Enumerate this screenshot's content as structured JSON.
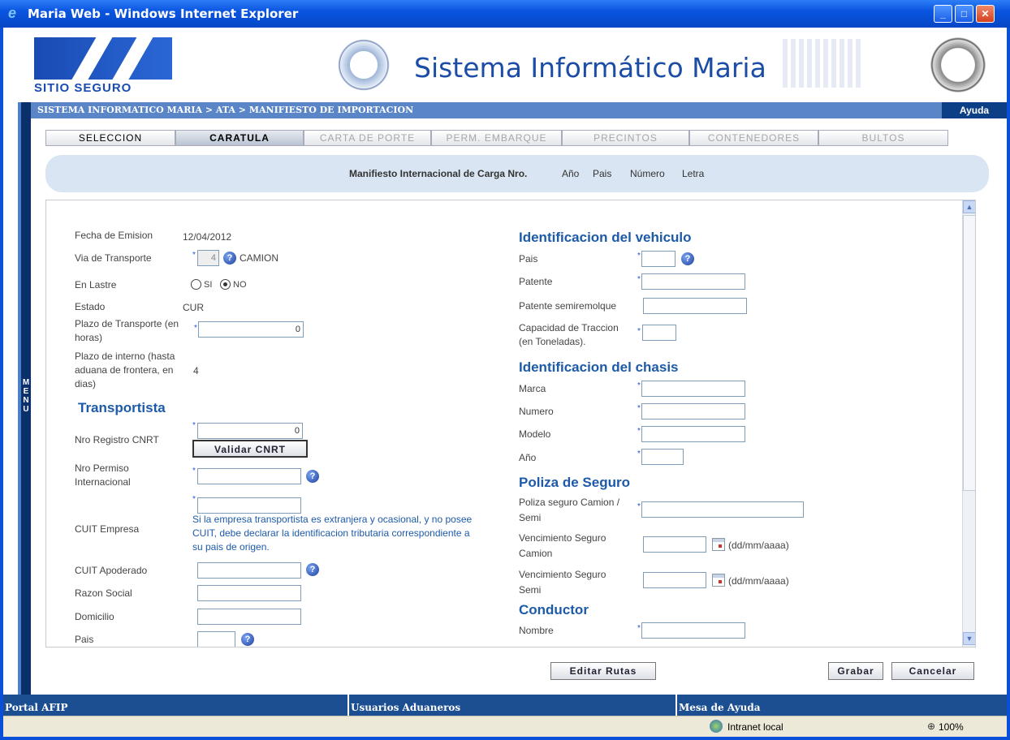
{
  "window": {
    "title": "Maria Web - Windows Internet Explorer"
  },
  "header": {
    "logo_text": "SITIO SEGURO",
    "system_title": "Sistema Informático Maria"
  },
  "breadcrumb": "SISTEMA INFORMATICO MARIA > ATA > MANIFIESTO DE IMPORTACION",
  "help_link": "Ayuda",
  "side_menu": "MENU",
  "tabs": [
    {
      "label": "SELECCION",
      "state": "enabled"
    },
    {
      "label": "CARATULA",
      "state": "active"
    },
    {
      "label": "CARTA DE PORTE",
      "state": "disabled"
    },
    {
      "label": "PERM. EMBARQUE",
      "state": "disabled"
    },
    {
      "label": "PRECINTOS",
      "state": "disabled"
    },
    {
      "label": "CONTENEDORES",
      "state": "disabled"
    },
    {
      "label": "BULTOS",
      "state": "disabled"
    }
  ],
  "manifest": {
    "label": "Manifiesto Internacional de Carga Nro.",
    "ano": "Año",
    "pais": "Pais",
    "numero": "Número",
    "letra": "Letra"
  },
  "left": {
    "fecha_label": "Fecha de Emision",
    "fecha_value": "12/04/2012",
    "via_label": "Via de Transporte",
    "via_value": "4",
    "via_text": "CAMION",
    "lastre_label": "En Lastre",
    "lastre_si": "SI",
    "lastre_no": "NO",
    "estado_label": "Estado",
    "estado_value": "CUR",
    "plazo_label": "Plazo de Transporte (en horas)",
    "plazo_value": "0",
    "plazo_int_label": "Plazo de interno (hasta aduana de frontera, en dias)",
    "plazo_int_value": "4",
    "transportista_heading": "Transportista",
    "cnrt_label": "Nro Registro CNRT",
    "cnrt_value": "0",
    "validar_button": "Validar CNRT",
    "permiso_label": "Nro Permiso Internacional",
    "cuit_label": "CUIT Empresa",
    "cuit_note": "Si la empresa transportista es extranjera y ocasional, y no posee CUIT, debe declarar la identificacion tributaria correspondiente a su pais de origen.",
    "apoderado_label": "CUIT Apoderado",
    "razon_label": "Razon Social",
    "domicilio_label": "Domicilio",
    "pais_label": "Pais"
  },
  "right": {
    "vehiculo_heading": "Identificacion del vehiculo",
    "pais_label": "Pais",
    "patente_label": "Patente",
    "semi_label": "Patente semiremolque",
    "capacidad_label": "Capacidad de Traccion (en Toneladas).",
    "chasis_heading": "Identificacion del chasis",
    "marca_label": "Marca",
    "numero_label": "Numero",
    "modelo_label": "Modelo",
    "ano_label": "Año",
    "poliza_heading": "Poliza de Seguro",
    "poliza_label": "Poliza seguro Camion / Semi",
    "venc_camion_label": "Vencimiento Seguro Camion",
    "venc_semi_label": "Vencimiento Seguro Semi",
    "date_format": "(dd/mm/aaaa)",
    "conductor_heading": "Conductor",
    "nombre_label": "Nombre"
  },
  "actions": {
    "editar": "Editar Rutas",
    "grabar": "Grabar",
    "cancelar": "Cancelar"
  },
  "footer": {
    "portal": "Portal AFIP",
    "usuarios": "Usuarios Aduaneros",
    "mesa": "Mesa de Ayuda"
  },
  "status": {
    "zone": "Intranet local",
    "zoom": "100%"
  },
  "colors": {
    "accent": "#1d5aa8",
    "bar": "#1c4f91",
    "title": "#0a55e0"
  }
}
